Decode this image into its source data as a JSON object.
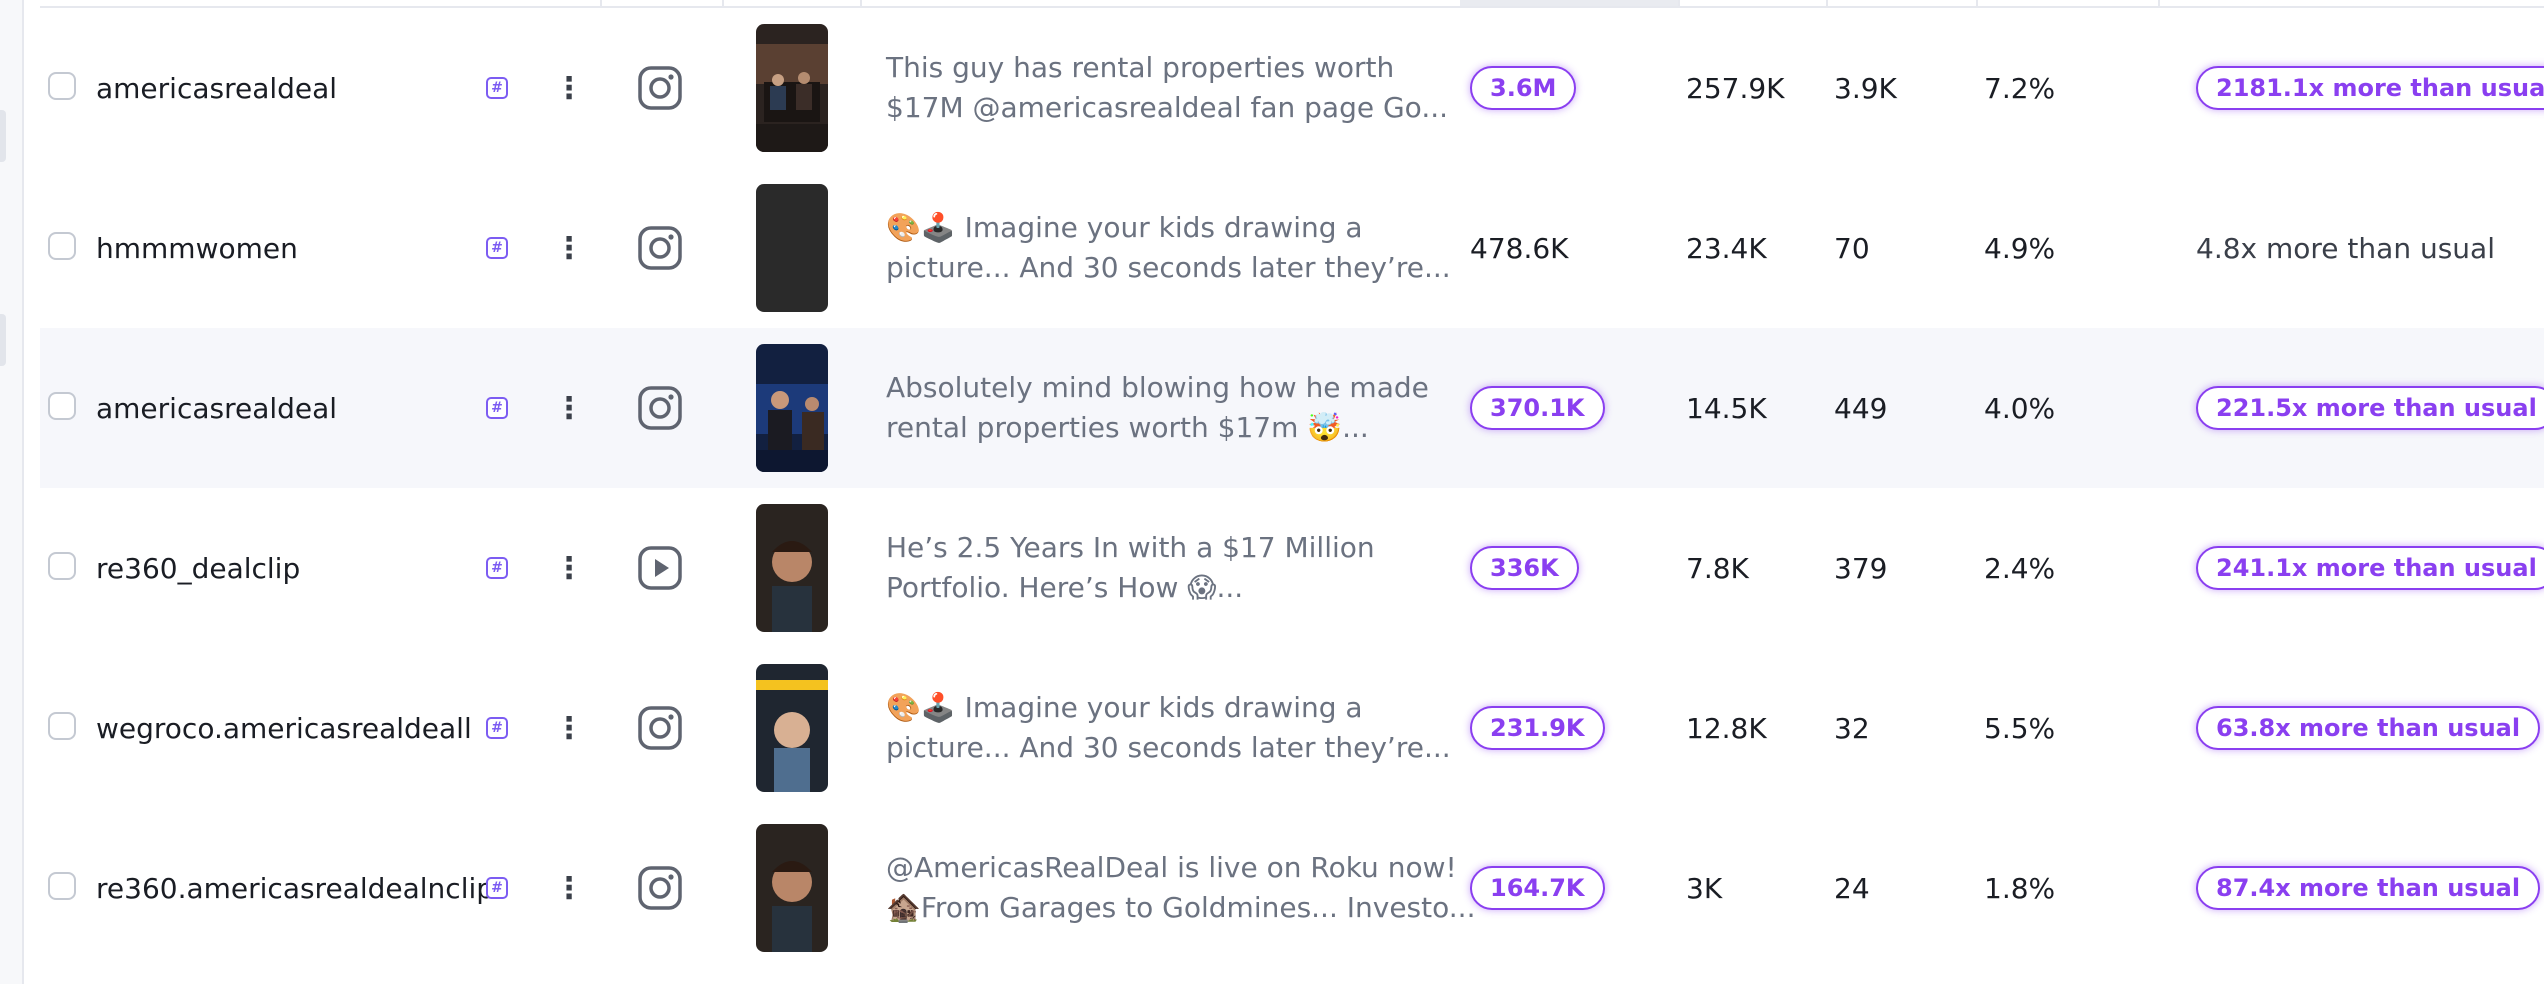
{
  "rows": [
    {
      "username": "americasrealdeal",
      "platform_icon": "instagram-icon",
      "thumb_style": "dark-stage",
      "caption_line1": "This guy has rental properties worth",
      "caption_line2": "$17M @americasrealdeal fan page Go...",
      "views": "3.6M",
      "views_highlight": true,
      "likes": "257.9K",
      "comments": "3.9K",
      "engagement": "7.2%",
      "outlier": "2181.1x more than usual",
      "outlier_highlight": true,
      "highlighted_row": false
    },
    {
      "username": "hmmmwomen",
      "platform_icon": "instagram-icon",
      "thumb_style": "blank",
      "caption_line1": "🎨🕹️ Imagine your kids drawing a",
      "caption_line2": "picture... And 30 seconds later they’re...",
      "views": "478.6K",
      "views_highlight": false,
      "likes": "23.4K",
      "comments": "70",
      "engagement": "4.9%",
      "outlier": "4.8x more than usual",
      "outlier_highlight": false,
      "highlighted_row": false
    },
    {
      "username": "americasrealdeal",
      "platform_icon": "instagram-icon",
      "thumb_style": "blue-stage",
      "caption_line1": "Absolutely mind blowing how he made",
      "caption_line2": "rental properties worth $17m 🤯...",
      "views": "370.1K",
      "views_highlight": true,
      "likes": "14.5K",
      "comments": "449",
      "engagement": "4.0%",
      "outlier": "221.5x more than usual",
      "outlier_highlight": true,
      "highlighted_row": true
    },
    {
      "username": "re360_dealclip",
      "platform_icon": "youtube-play-icon",
      "thumb_style": "portrait",
      "caption_line1": "He’s 2.5 Years In with a $17 Million",
      "caption_line2": "Portfolio. Here’s How 😱...",
      "views": "336K",
      "views_highlight": true,
      "likes": "7.8K",
      "comments": "379",
      "engagement": "2.4%",
      "outlier": "241.1x more than usual",
      "outlier_highlight": true,
      "highlighted_row": false
    },
    {
      "username": "wegroco.americasrealdeall",
      "platform_icon": "instagram-icon",
      "thumb_style": "portrait-light",
      "caption_line1": "🎨🕹️ Imagine your kids drawing a",
      "caption_line2": "picture... And 30 seconds later they’re...",
      "views": "231.9K",
      "views_highlight": true,
      "likes": "12.8K",
      "comments": "32",
      "engagement": "5.5%",
      "outlier": "63.8x more than usual",
      "outlier_highlight": true,
      "highlighted_row": false
    },
    {
      "username": "re360.americasrealdealnclip",
      "platform_icon": "instagram-icon",
      "thumb_style": "portrait",
      "caption_line1": "@AmericasRealDeal is live on Roku now!",
      "caption_line2": "🏚️From Garages to Goldmines... Investo...",
      "views": "164.7K",
      "views_highlight": true,
      "likes": "3K",
      "comments": "24",
      "engagement": "1.8%",
      "outlier": "87.4x more than usual",
      "outlier_highlight": true,
      "highlighted_row": false
    }
  ],
  "colors": {
    "accent_purple": "#8a3ff0",
    "tag_purple": "#7c5cf2",
    "text_primary": "#1a1d24",
    "text_muted": "#6b7280",
    "row_highlight": "#f6f7fb"
  }
}
